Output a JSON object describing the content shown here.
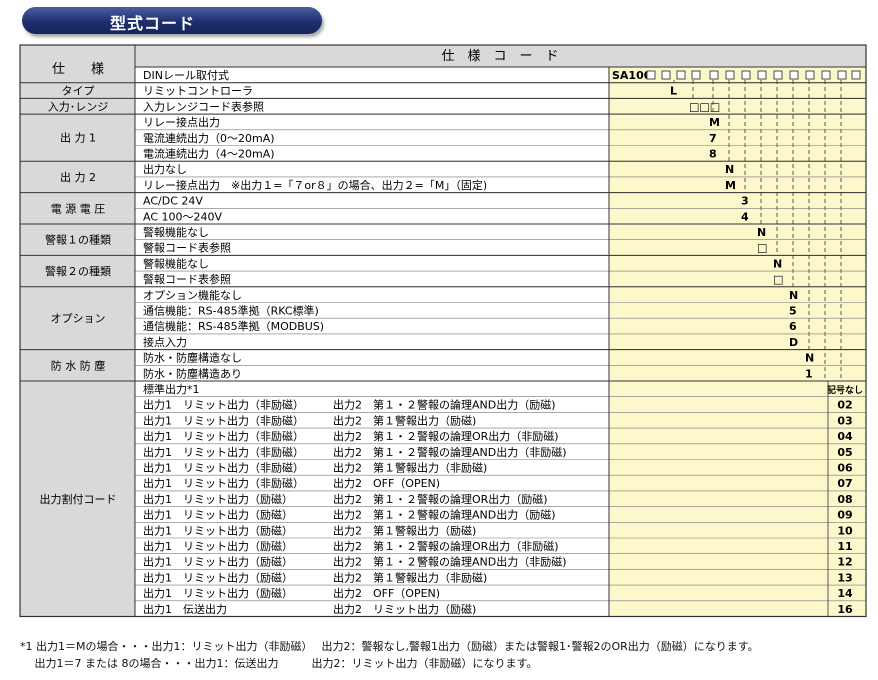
{
  "title": "型式コード",
  "header": {
    "spec": "仕　　様",
    "code": "仕　様　コ　ー　ド"
  },
  "model": {
    "label": "DINレール取付式",
    "code": "SA100"
  },
  "groups": [
    {
      "label": "タイプ",
      "items": [
        {
          "text": "リミットコントローラ",
          "code": "L"
        }
      ]
    },
    {
      "label": "入力･レンジ",
      "items": [
        {
          "text": "入力レンジコード表参照",
          "code": "□□□"
        }
      ]
    },
    {
      "label": "出 力 1",
      "items": [
        {
          "text": "リレー接点出力",
          "code": "M"
        },
        {
          "text": "電流連続出力（0～20mA)",
          "code": "7"
        },
        {
          "text": "電流連続出力（4～20mA)",
          "code": "8"
        }
      ]
    },
    {
      "label": "出 力 2",
      "items": [
        {
          "text": "出力なし",
          "code": "N"
        },
        {
          "text": "リレー接点出力　※出力１=「７or８」の場合、出力２=「M」（固定)",
          "code": "M"
        }
      ]
    },
    {
      "label": "電 源 電 圧",
      "items": [
        {
          "text": "AC/DC 24V",
          "code": "3"
        },
        {
          "text": "AC 100～240V",
          "code": "4"
        }
      ]
    },
    {
      "label": "警報１の種類",
      "items": [
        {
          "text": "警報機能なし",
          "code": "N"
        },
        {
          "text": "警報コード表参照",
          "code": "□"
        }
      ]
    },
    {
      "label": "警報２の種類",
      "items": [
        {
          "text": "警報機能なし",
          "code": "N"
        },
        {
          "text": "警報コード表参照",
          "code": "□"
        }
      ]
    },
    {
      "label": "オプション",
      "items": [
        {
          "text": "オプション機能なし",
          "code": "N"
        },
        {
          "text": "通信機能：RS-485準拠（RKC標準)",
          "code": "5"
        },
        {
          "text": "通信機能：RS-485準拠（MODBUS)",
          "code": "6"
        },
        {
          "text": "接点入力",
          "code": "D"
        }
      ]
    },
    {
      "label": "防 水 防 塵",
      "items": [
        {
          "text": "防水・防塵構造なし",
          "code": "N"
        },
        {
          "text": "防水・防塵構造あり",
          "code": "1"
        }
      ]
    }
  ],
  "output_assign": {
    "label": "出力割付コード",
    "rows": [
      {
        "o1": "標準出力*1",
        "o2": "",
        "code": "記号なし"
      },
      {
        "o1": "出力1　リミット出力（非励磁）",
        "o2": "出力2　第１・２警報の論理AND出力（励磁)",
        "code": "02"
      },
      {
        "o1": "出力1　リミット出力（非励磁）",
        "o2": "出力2　第１警報出力（励磁)",
        "code": "03"
      },
      {
        "o1": "出力1　リミット出力（非励磁）",
        "o2": "出力2　第１・２警報の論理OR出力（非励磁)",
        "code": "04"
      },
      {
        "o1": "出力1　リミット出力（非励磁）",
        "o2": "出力2　第１・２警報の論理AND出力（非励磁)",
        "code": "05"
      },
      {
        "o1": "出力1　リミット出力（非励磁）",
        "o2": "出力2　第１警報出力（非励磁)",
        "code": "06"
      },
      {
        "o1": "出力1　リミット出力（非励磁）",
        "o2": "出力2　OFF（OPEN)",
        "code": "07"
      },
      {
        "o1": "出力1　リミット出力（励磁）",
        "o2": "出力2　第１・２警報の論理OR出力（励磁)",
        "code": "08"
      },
      {
        "o1": "出力1　リミット出力（励磁）",
        "o2": "出力2　第１・２警報の論理AND出力（励磁)",
        "code": "09"
      },
      {
        "o1": "出力1　リミット出力（励磁）",
        "o2": "出力2　第１警報出力（励磁)",
        "code": "10"
      },
      {
        "o1": "出力1　リミット出力（励磁）",
        "o2": "出力2　第１・２警報の論理OR出力（非励磁)",
        "code": "11"
      },
      {
        "o1": "出力1　リミット出力（励磁）",
        "o2": "出力2　第１・２警報の論理AND出力（非励磁)",
        "code": "12"
      },
      {
        "o1": "出力1　リミット出力（励磁）",
        "o2": "出力2　第１警報出力（非励磁)",
        "code": "13"
      },
      {
        "o1": "出力1　リミット出力（励磁）",
        "o2": "出力2　OFF（OPEN)",
        "code": "14"
      },
      {
        "o1": "出力1　伝送出力",
        "o2": "出力2　リミット出力（励磁)",
        "code": "16"
      }
    ]
  },
  "footnotes": [
    "*1 出力1＝Mの場合・・・出力1：リミット出力（非励磁）　 出力2：警報なし,警報1出力（励磁）または警報1･警報2のOR出力（励磁）になります。",
    "　 出力1＝7 または 8の場合・・・出力1：伝送出力　　　出力2：リミット出力（非励磁）になります。"
  ],
  "colors": {
    "label_bg": "#d9d9d9",
    "code_bg": "#fdf7cc",
    "border": "#333333",
    "title_bg": "#1e2f6e"
  }
}
